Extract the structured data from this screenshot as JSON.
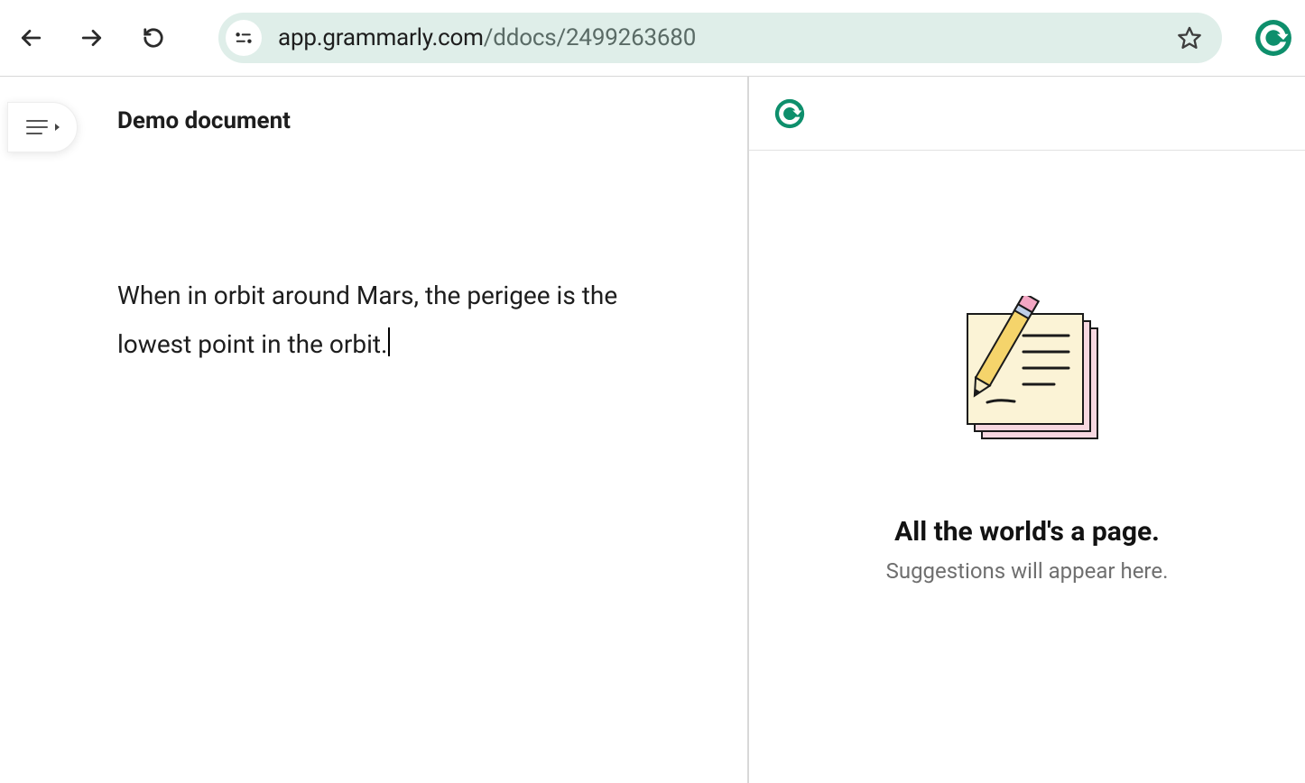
{
  "browser": {
    "url_host": "app.grammarly.com",
    "url_path": "/ddocs/2499263680"
  },
  "document": {
    "title": "Demo document",
    "body": "When in orbit around Mars, the perigee is the lowest point in the orbit."
  },
  "sidebar": {
    "empty_title": "All the world's a page.",
    "empty_subtitle": "Suggestions will appear here."
  }
}
